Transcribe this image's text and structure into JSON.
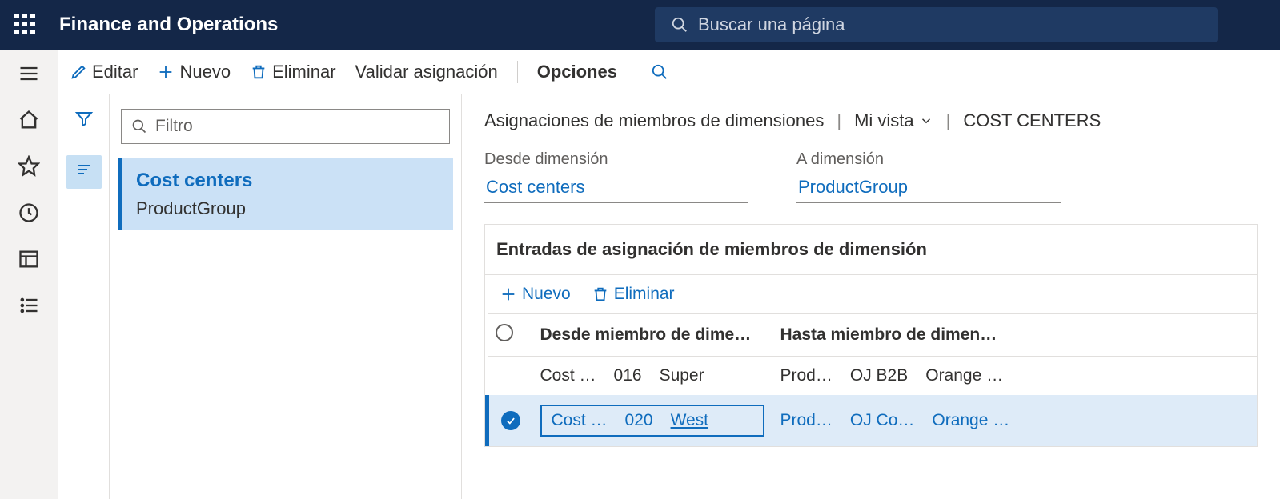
{
  "header": {
    "app_title": "Finance and Operations",
    "search_placeholder": "Buscar una página"
  },
  "cmdbar": {
    "edit": "Editar",
    "new": "Nuevo",
    "delete": "Eliminar",
    "validate": "Validar asignación",
    "options": "Opciones"
  },
  "list": {
    "filter_placeholder": "Filtro",
    "item": {
      "title": "Cost centers",
      "subtitle": "ProductGroup"
    }
  },
  "crumbs": {
    "page": "Asignaciones de miembros de dimensiones",
    "view": "Mi vista",
    "entity": "COST CENTERS"
  },
  "fields": {
    "from_label": "Desde dimensión",
    "from_value": "Cost centers",
    "to_label": "A dimensión",
    "to_value": "ProductGroup"
  },
  "section_title": "Entradas de asignación de miembros de dimensión",
  "grid": {
    "toolbar": {
      "new": "Nuevo",
      "delete": "Eliminar"
    },
    "headers": {
      "from": "Desde miembro de dime…",
      "to": "Hasta miembro de dimen…"
    },
    "rows": [
      {
        "selected": false,
        "from_a": "Cost …",
        "from_b": "016",
        "from_c": "Super",
        "to_a": "Prod…",
        "to_b": "OJ B2B",
        "to_c": "Orange …"
      },
      {
        "selected": true,
        "from_a": "Cost …",
        "from_b": "020",
        "from_c": "West",
        "to_a": "Prod…",
        "to_b": "OJ Co…",
        "to_c": "Orange …"
      }
    ]
  }
}
